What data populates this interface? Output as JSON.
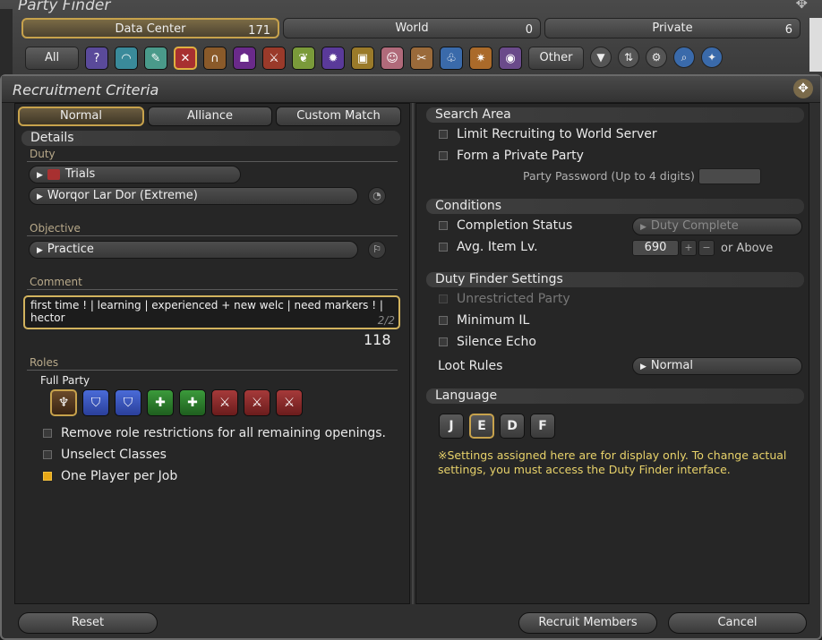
{
  "party_finder": {
    "title": "Party Finder",
    "tabs": [
      {
        "label": "Data Center",
        "count": "171"
      },
      {
        "label": "World",
        "count": "0"
      },
      {
        "label": "Private",
        "count": "6"
      }
    ],
    "all_label": "All",
    "other_label": "Other"
  },
  "window": {
    "title": "Recruitment Criteria"
  },
  "modes": [
    "Normal",
    "Alliance",
    "Custom Match"
  ],
  "details": {
    "heading": "Details",
    "duty_label": "Duty",
    "duty_category": "Trials",
    "duty_name": "Worqor Lar Dor (Extreme)",
    "objective_label": "Objective",
    "objective_value": "Practice",
    "comment_label": "Comment",
    "comment_text": "first time ! | learning | experienced + new welc | need markers ! | hector",
    "comment_page": "2/2",
    "comment_remaining": "118"
  },
  "roles": {
    "label": "Roles",
    "party_label": "Full Party"
  },
  "left_options": [
    {
      "label": "Remove role restrictions for all remaining openings.",
      "checked": false
    },
    {
      "label": "Unselect Classes",
      "checked": false
    },
    {
      "label": "One Player per Job",
      "checked": true
    }
  ],
  "search_area": {
    "heading": "Search Area",
    "limit_world": "Limit Recruiting to World Server",
    "private_party": "Form a Private Party",
    "password_label": "Party Password (Up to 4 digits)"
  },
  "conditions": {
    "heading": "Conditions",
    "completion_label": "Completion Status",
    "completion_value": "Duty Complete",
    "item_level_label": "Avg. Item Lv.",
    "item_level_value": "690",
    "item_level_suffix": "or Above"
  },
  "duty_finder": {
    "heading": "Duty Finder Settings",
    "unrestricted": "Unrestricted Party",
    "min_il": "Minimum IL",
    "silence_echo": "Silence Echo",
    "loot_label": "Loot Rules",
    "loot_value": "Normal"
  },
  "language": {
    "heading": "Language",
    "options": [
      "J",
      "E",
      "D",
      "F"
    ],
    "note": "※Settings assigned here are for display only. To change actual settings, you must access the Duty Finder interface."
  },
  "buttons": {
    "reset": "Reset",
    "recruit": "Recruit Members",
    "cancel": "Cancel"
  },
  "colors": {
    "accent_gold": "#c7a24c",
    "note_yellow": "#e8d26a",
    "check_on": "#e8a816"
  }
}
